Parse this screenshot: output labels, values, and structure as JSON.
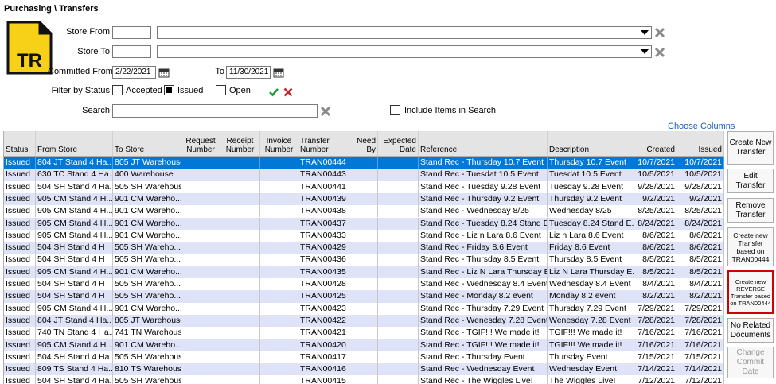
{
  "breadcrumb": "Purchasing \\ Transfers",
  "doc_icon_text": "TR",
  "filters": {
    "store_from_label": "Store From",
    "store_to_label": "Store To",
    "committed_from_label": "Committed From",
    "committed_from_value": "2/22/2021",
    "to_label": "To",
    "to_value": "11/30/2021",
    "filter_status_label": "Filter by Status",
    "status_accepted": "Accepted",
    "status_issued": "Issued",
    "status_open": "Open",
    "search_label": "Search",
    "include_items_label": "Include Items in Search",
    "choose_columns": "Choose Columns"
  },
  "columns": {
    "status": "Status",
    "from_store": "From Store",
    "to_store": "To Store",
    "request_number": "Request Number",
    "receipt_number": "Receipt Number",
    "invoice_number": "Invoice Number",
    "transfer_number": "Transfer Number",
    "need_by": "Need By",
    "expected_date": "Expected Date",
    "reference": "Reference",
    "description": "Description",
    "created": "Created",
    "issued": "Issued"
  },
  "rows": [
    {
      "status": "Issued",
      "from": "804 JT Stand 4 Ha...",
      "to": "805 JT Warehouse",
      "transfer": "TRAN00444",
      "reference": "Stand Rec - Thursday 10.7 Event",
      "description": "Thursday 10.7 Event",
      "created": "10/7/2021",
      "issued": "10/7/2021"
    },
    {
      "status": "Issued",
      "from": "630 TC Stand 4 Ha...",
      "to": "400 Warehouse",
      "transfer": "TRAN00443",
      "reference": "Stand Rec - Tuesdat 10.5 Event",
      "description": "Tuesdat 10.5 Event",
      "created": "10/5/2021",
      "issued": "10/5/2021"
    },
    {
      "status": "Issued",
      "from": "504 SH Stand 4 Ha...",
      "to": "505 SH Warehouse",
      "transfer": "TRAN00441",
      "reference": "Stand Rec - Tuesday 9.28 Event",
      "description": "Tuesday 9.28 Event",
      "created": "9/28/2021",
      "issued": "9/28/2021"
    },
    {
      "status": "Issued",
      "from": "905 CM Stand 4 H...",
      "to": "901 CM Wareho...",
      "transfer": "TRAN00439",
      "reference": "Stand Rec - Thursday 9.2 Event",
      "description": "Thursday 9.2 Event",
      "created": "9/2/2021",
      "issued": "9/2/2021"
    },
    {
      "status": "Issued",
      "from": "905 CM Stand 4 H...",
      "to": "901 CM Wareho...",
      "transfer": "TRAN00438",
      "reference": "Stand Rec - Wednesday 8/25",
      "description": "Wednesday 8/25",
      "created": "8/25/2021",
      "issued": "8/25/2021"
    },
    {
      "status": "Issued",
      "from": "905 CM Stand 4 H...",
      "to": "901 CM Wareho...",
      "transfer": "TRAN00437",
      "reference": "Stand Rec - Tuesday 8.24 Stand Ev...",
      "description": "Tuesday 8.24 Stand E...",
      "created": "8/24/2021",
      "issued": "8/24/2021"
    },
    {
      "status": "Issued",
      "from": "905 CM Stand 4 H...",
      "to": "901 CM Wareho...",
      "transfer": "TRAN00433",
      "reference": "Stand Rec - Liz n Lara 8.6 Event",
      "description": "Liz n Lara 8.6 Event",
      "created": "8/6/2021",
      "issued": "8/6/2021"
    },
    {
      "status": "Issued",
      "from": "504 SH Stand 4 H",
      "to": "505 SH Wareho...",
      "transfer": "TRAN00429",
      "reference": "Stand Rec - Friday 8.6 Event",
      "description": "Friday 8.6 Event",
      "created": "8/6/2021",
      "issued": "8/6/2021"
    },
    {
      "status": "Issued",
      "from": "504 SH Stand 4 H",
      "to": "505 SH Wareho...",
      "transfer": "TRAN00436",
      "reference": "Stand Rec - Thursday 8.5 Event",
      "description": "Thursday 8.5 Event",
      "created": "8/5/2021",
      "issued": "8/5/2021"
    },
    {
      "status": "Issued",
      "from": "905 CM Stand 4 H...",
      "to": "901 CM Wareho...",
      "transfer": "TRAN00435",
      "reference": "Stand Rec - Liz N Lara Thursday Ev...",
      "description": "Liz N Lara Thursday E...",
      "created": "8/5/2021",
      "issued": "8/5/2021"
    },
    {
      "status": "Issued",
      "from": "504 SH Stand 4 H",
      "to": "505 SH Wareho...",
      "transfer": "TRAN00428",
      "reference": "Stand Rec - Wednesday 8.4 Event",
      "description": "Wednesday 8.4 Event",
      "created": "8/4/2021",
      "issued": "8/4/2021"
    },
    {
      "status": "Issued",
      "from": "504 SH Stand 4 H",
      "to": "505 SH Wareho...",
      "transfer": "TRAN00425",
      "reference": "Stand Rec - Monday 8.2 event",
      "description": "Monday 8.2 event",
      "created": "8/2/2021",
      "issued": "8/2/2021"
    },
    {
      "status": "Issued",
      "from": "905 CM Stand 4 H...",
      "to": "901 CM Wareho...",
      "transfer": "TRAN00423",
      "reference": "Stand Rec - Thursday 7.29 Event",
      "description": "Thursday 7.29 Event",
      "created": "7/29/2021",
      "issued": "7/29/2021"
    },
    {
      "status": "Issued",
      "from": "804 JT Stand 4 Ha...",
      "to": "805 JT Warehouse",
      "transfer": "TRAN00422",
      "reference": "Stand Rec - Wenesday 7.28 Event",
      "description": "Wenesday 7.28 Event ...",
      "created": "7/28/2021",
      "issued": "7/28/2021"
    },
    {
      "status": "Issued",
      "from": "740 TN Stand 4 Ha...",
      "to": "741 TN Warehouse",
      "transfer": "TRAN00421",
      "reference": "Stand Rec - TGIF!!! We made it!",
      "description": "TGIF!!! We made it!",
      "created": "7/16/2021",
      "issued": "7/16/2021"
    },
    {
      "status": "Issued",
      "from": "905 CM Stand 4 H...",
      "to": "901 CM Wareho...",
      "transfer": "TRAN00420",
      "reference": "Stand Rec - TGIF!!! We made it!",
      "description": "TGIF!!! We made it!",
      "created": "7/16/2021",
      "issued": "7/16/2021"
    },
    {
      "status": "Issued",
      "from": "504 SH Stand 4 Ha...",
      "to": "505 SH Warehouse",
      "transfer": "TRAN00417",
      "reference": "Stand Rec - Thursday Event",
      "description": "Thursday Event",
      "created": "7/15/2021",
      "issued": "7/15/2021"
    },
    {
      "status": "Issued",
      "from": "809 TS Stand 4 Ha...",
      "to": "810 TS Warehouse",
      "transfer": "TRAN00416",
      "reference": "Stand Rec - Wednesday Event",
      "description": "Wednesday Event",
      "created": "7/14/2021",
      "issued": "7/14/2021"
    },
    {
      "status": "Issued",
      "from": "504 SH Stand 4 Ha...",
      "to": "505 SH Warehouse",
      "transfer": "TRAN00415",
      "reference": "Stand Rec - The Wiggles Live!",
      "description": "The Wiggles Live!",
      "created": "7/12/2021",
      "issued": "7/12/2021"
    }
  ],
  "side_buttons": {
    "create": "Create New Transfer",
    "edit": "Edit Transfer",
    "remove": "Remove Transfer",
    "create_based": "Create new Transfer based on TRAN00444",
    "create_reverse": "Create new REVERSE Transfer based on TRAN00444",
    "no_related": "No Related Documents",
    "change_commit": "Change Commit Date"
  },
  "colors": {
    "selected_row": "#0078d7",
    "alt_row": "#dfe3f7",
    "highlight_border": "#d00000",
    "icon_yellow": "#f7d117"
  }
}
